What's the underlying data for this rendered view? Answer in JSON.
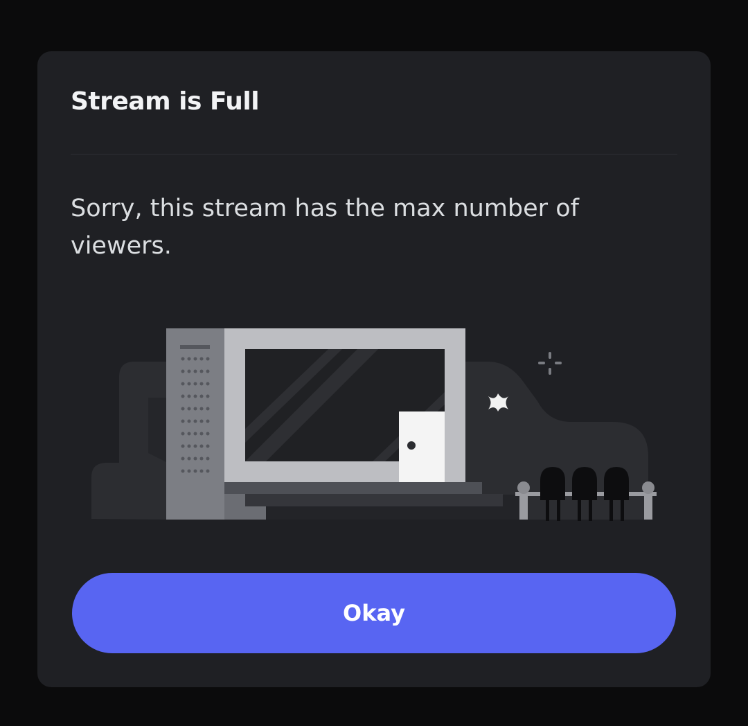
{
  "modal": {
    "title": "Stream is Full",
    "message": "Sorry, this stream has the max number of viewers.",
    "button_label": "Okay"
  },
  "colors": {
    "background": "#0b0b0c",
    "modal_background": "#1f2024",
    "title_text": "#f2f3f5",
    "body_text": "#dbdee1",
    "primary_button": "#5865f2"
  },
  "illustration": {
    "name": "full-stream-theater-illustration",
    "icons": [
      "sparkle-icon",
      "spark-burst-icon",
      "door-icon"
    ]
  }
}
